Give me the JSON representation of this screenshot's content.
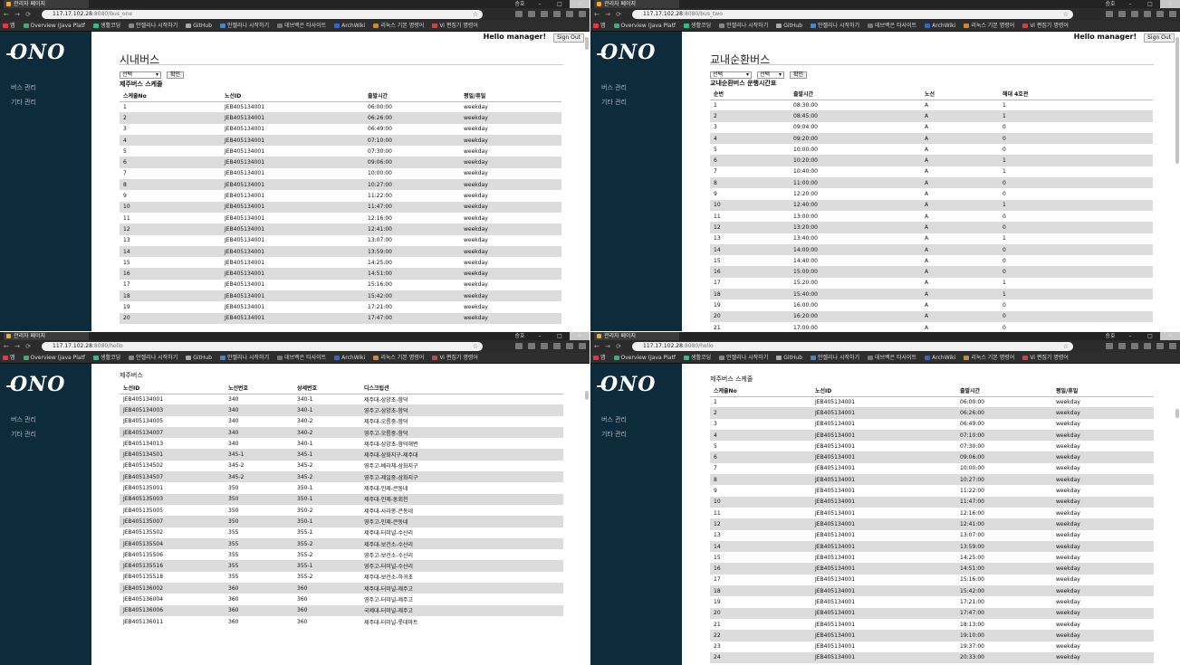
{
  "window": {
    "tab_title": "관리자 페이지",
    "user": "승호"
  },
  "bookmarks": [
    "앱",
    "Overview (Java Platf",
    "생활코딩",
    "안젤리나 시작하기",
    "GitHub",
    "안젤리나 시작하기",
    "데브백은 타사이트",
    "ArchWiki",
    "리눅스 기본 명령어",
    "Vi 편집기 명령어"
  ],
  "common": {
    "menu": [
      "버스 관리",
      "기타 관리"
    ],
    "greeting": "Hello manager!",
    "signout": "Sign Out",
    "select_placeholder": "선택",
    "confirm": "확인"
  },
  "p1": {
    "url_host": "117.17.102.28",
    "url_path": ":8080/bus_one",
    "title": "시내버스",
    "sub": "제주버스 스케줄",
    "headers": [
      "스케줄No",
      "노선ID",
      "출발시간",
      "평일/휴일"
    ],
    "rows": [
      [
        "1",
        "JEB405134001",
        "06:00:00",
        "weekday"
      ],
      [
        "2",
        "JEB405134001",
        "06:26:00",
        "weekday"
      ],
      [
        "3",
        "JEB405134001",
        "06:49:00",
        "weekday"
      ],
      [
        "4",
        "JEB405134001",
        "07:10:00",
        "weekday"
      ],
      [
        "5",
        "JEB405134001",
        "07:30:00",
        "weekday"
      ],
      [
        "6",
        "JEB405134001",
        "09:06:00",
        "weekday"
      ],
      [
        "7",
        "JEB405134001",
        "10:00:00",
        "weekday"
      ],
      [
        "8",
        "JEB405134001",
        "10:27:00",
        "weekday"
      ],
      [
        "9",
        "JEB405134001",
        "11:22:00",
        "weekday"
      ],
      [
        "10",
        "JEB405134001",
        "11:47:00",
        "weekday"
      ],
      [
        "11",
        "JEB405134001",
        "12:16:00",
        "weekday"
      ],
      [
        "12",
        "JEB405134001",
        "12:41:00",
        "weekday"
      ],
      [
        "13",
        "JEB405134001",
        "13:07:00",
        "weekday"
      ],
      [
        "14",
        "JEB405134001",
        "13:59:00",
        "weekday"
      ],
      [
        "15",
        "JEB405134001",
        "14:25:00",
        "weekday"
      ],
      [
        "16",
        "JEB405134001",
        "14:51:00",
        "weekday"
      ],
      [
        "17",
        "JEB405134001",
        "15:16:00",
        "weekday"
      ],
      [
        "18",
        "JEB405134001",
        "15:42:00",
        "weekday"
      ],
      [
        "19",
        "JEB405134001",
        "17:21:00",
        "weekday"
      ],
      [
        "20",
        "JEB405134001",
        "17:47:00",
        "weekday"
      ]
    ]
  },
  "p2": {
    "url_host": "117.17.102.28",
    "url_path": ":8080/bus_two",
    "title": "교내순환버스",
    "sub": "교내순환버스 운행시간표",
    "headers": [
      "순번",
      "출발시간",
      "노선",
      "해대 4호관"
    ],
    "rows": [
      [
        "1",
        "08:30:00",
        "A",
        "1"
      ],
      [
        "2",
        "08:45:00",
        "A",
        "1"
      ],
      [
        "3",
        "09:04:00",
        "A",
        "0"
      ],
      [
        "4",
        "09:20:00",
        "A",
        "0"
      ],
      [
        "5",
        "10:00:00",
        "A",
        "0"
      ],
      [
        "6",
        "10:20:00",
        "A",
        "1"
      ],
      [
        "7",
        "10:40:00",
        "A",
        "1"
      ],
      [
        "8",
        "11:00:00",
        "A",
        "0"
      ],
      [
        "9",
        "12:20:00",
        "A",
        "0"
      ],
      [
        "10",
        "12:40:00",
        "A",
        "1"
      ],
      [
        "11",
        "13:00:00",
        "A",
        "0"
      ],
      [
        "12",
        "13:20:00",
        "A",
        "0"
      ],
      [
        "13",
        "13:40:00",
        "A",
        "1"
      ],
      [
        "14",
        "14:00:00",
        "A",
        "0"
      ],
      [
        "15",
        "14:40:00",
        "A",
        "0"
      ],
      [
        "16",
        "15:00:00",
        "A",
        "0"
      ],
      [
        "17",
        "15:20:00",
        "A",
        "1"
      ],
      [
        "18",
        "15:40:00",
        "A",
        "1"
      ],
      [
        "19",
        "16:00:00",
        "A",
        "0"
      ],
      [
        "20",
        "16:20:00",
        "A",
        "0"
      ],
      [
        "21",
        "17:00:00",
        "A",
        "0"
      ]
    ]
  },
  "p3": {
    "url_host": "117.17.102.28",
    "url_path": ":8080/hello",
    "sub": "제주버스",
    "headers": [
      "노선ID",
      "노선번호",
      "상세번호",
      "디스크립션"
    ],
    "rows": [
      [
        "JEB405134001",
        "340",
        "340-1",
        "제주대-삼양초-함덕"
      ],
      [
        "JEB405134003",
        "340",
        "340-1",
        "영주고-삼양초-함덕"
      ],
      [
        "JEB405134005",
        "340",
        "340-2",
        "제주대-오름중-함덕"
      ],
      [
        "JEB405134007",
        "340",
        "340-2",
        "영주고-오름중-함덕"
      ],
      [
        "JEB405134013",
        "340",
        "340-1",
        "제주대-삼양초-함덕해변"
      ],
      [
        "JEB405134501",
        "345-1",
        "345-1",
        "제주대-삼화지구-제주대"
      ],
      [
        "JEB405134502",
        "345-2",
        "345-2",
        "영주고-베라체-삼화지구"
      ],
      [
        "JEB405134507",
        "345-2",
        "345-2",
        "영주고-제일중-삼화지구"
      ],
      [
        "JEB405135001",
        "350",
        "350-1",
        "제주대-인제-큰동네"
      ],
      [
        "JEB405135003",
        "350",
        "350-1",
        "제주대-인제-동회천"
      ],
      [
        "JEB405135005",
        "350",
        "350-2",
        "제주대-사라봉-큰동네"
      ],
      [
        "JEB405135007",
        "350",
        "350-1",
        "영주고-인제-큰동네"
      ],
      [
        "JEB405135502",
        "355",
        "355-1",
        "제주대-터미널-수산리"
      ],
      [
        "JEB405135504",
        "355",
        "355-2",
        "제주대-보건소-수산리"
      ],
      [
        "JEB405135506",
        "355",
        "355-2",
        "영주고-보건소-수산리"
      ],
      [
        "JEB405135516",
        "355",
        "355-1",
        "영주고-터미널-수산리"
      ],
      [
        "JEB405135518",
        "355",
        "355-2",
        "제주대-보건소-하귀초"
      ],
      [
        "JEB405136002",
        "360",
        "360",
        "제주대-터미널-제주고"
      ],
      [
        "JEB405136004",
        "360",
        "360",
        "영주고-터미널-제주고"
      ],
      [
        "JEB405136006",
        "360",
        "360",
        "국제대-터미널-제주고"
      ],
      [
        "JEB405136011",
        "360",
        "360",
        "제주대-터미널-롯데마트"
      ]
    ]
  },
  "p4": {
    "url_host": "117.17.102.28",
    "url_path": ":8080/hello",
    "sub": "제주버스 스케줄",
    "headers": [
      "스케줄No",
      "노선ID",
      "출발시간",
      "평일/휴일"
    ],
    "rows": [
      [
        "1",
        "JEB405134001",
        "06:00:00",
        "weekday"
      ],
      [
        "2",
        "JEB405134001",
        "06:26:00",
        "weekday"
      ],
      [
        "3",
        "JEB405134001",
        "06:49:00",
        "weekday"
      ],
      [
        "4",
        "JEB405134001",
        "07:10:00",
        "weekday"
      ],
      [
        "5",
        "JEB405134001",
        "07:30:00",
        "weekday"
      ],
      [
        "6",
        "JEB405134001",
        "09:06:00",
        "weekday"
      ],
      [
        "7",
        "JEB405134001",
        "10:00:00",
        "weekday"
      ],
      [
        "8",
        "JEB405134001",
        "10:27:00",
        "weekday"
      ],
      [
        "9",
        "JEB405134001",
        "11:22:00",
        "weekday"
      ],
      [
        "10",
        "JEB405134001",
        "11:47:00",
        "weekday"
      ],
      [
        "11",
        "JEB405134001",
        "12:16:00",
        "weekday"
      ],
      [
        "12",
        "JEB405134001",
        "12:41:00",
        "weekday"
      ],
      [
        "13",
        "JEB405134001",
        "13:07:00",
        "weekday"
      ],
      [
        "14",
        "JEB405134001",
        "13:59:00",
        "weekday"
      ],
      [
        "15",
        "JEB405134001",
        "14:25:00",
        "weekday"
      ],
      [
        "16",
        "JEB405134001",
        "14:51:00",
        "weekday"
      ],
      [
        "17",
        "JEB405134001",
        "15:16:00",
        "weekday"
      ],
      [
        "18",
        "JEB405134001",
        "15:42:00",
        "weekday"
      ],
      [
        "19",
        "JEB405134001",
        "17:21:00",
        "weekday"
      ],
      [
        "20",
        "JEB405134001",
        "17:47:00",
        "weekday"
      ],
      [
        "21",
        "JEB405134001",
        "18:13:00",
        "weekday"
      ],
      [
        "22",
        "JEB405134001",
        "19:10:00",
        "weekday"
      ],
      [
        "23",
        "JEB405134001",
        "19:37:00",
        "weekday"
      ],
      [
        "24",
        "JEB405134001",
        "20:33:00",
        "weekday"
      ]
    ]
  }
}
